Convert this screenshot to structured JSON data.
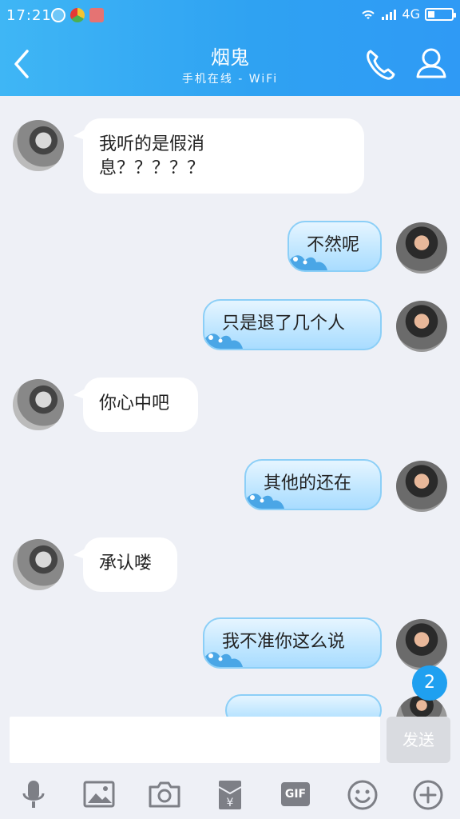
{
  "status": {
    "time": "17:21",
    "network": "4G"
  },
  "header": {
    "title": "烟鬼",
    "subtitle": "手机在线 - WiFi"
  },
  "messages": [
    {
      "side": "left",
      "text_line1": "我听的是假消",
      "text_line2": "息？？？？？"
    },
    {
      "side": "right",
      "text": "不然呢"
    },
    {
      "side": "right",
      "text": "只是退了几个人"
    },
    {
      "side": "left",
      "text": "你心中吧"
    },
    {
      "side": "right",
      "text": "其他的还在"
    },
    {
      "side": "left",
      "text": "承认喽"
    },
    {
      "side": "right",
      "text": "我不准你这么说"
    }
  ],
  "unread_count": "2",
  "input": {
    "send_label": "发送"
  },
  "toolbar": {
    "items": [
      "voice-icon",
      "image-icon",
      "camera-icon",
      "red-packet-icon",
      "gif-icon",
      "emoji-icon",
      "plus-icon"
    ],
    "gif_label": "GIF"
  },
  "colors": {
    "header_start": "#3fb6f5",
    "header_end": "#2f9af5",
    "bubble_right": "#bfe6ff",
    "bubble_left": "#ffffff",
    "badge": "#1fa0f0"
  }
}
